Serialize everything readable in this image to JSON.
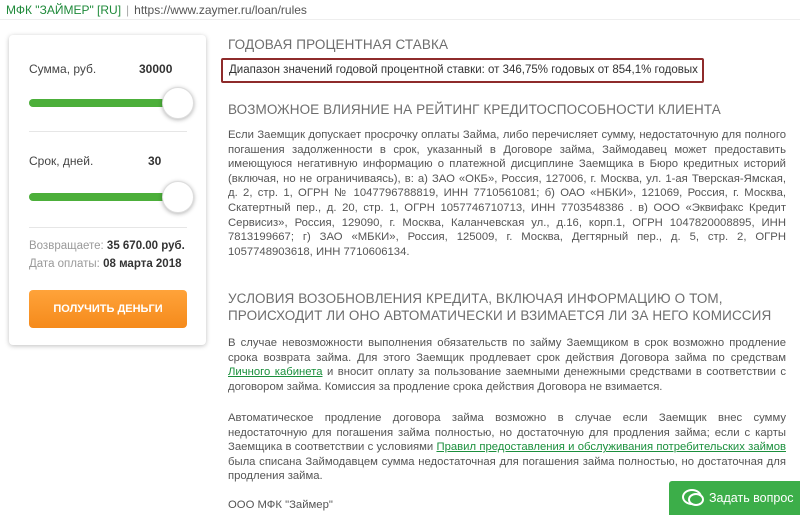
{
  "address_bar": {
    "site_identity": "МФК \"ЗАЙМЕР\" [RU]",
    "url": "https://www.zaymer.ru/loan/rules"
  },
  "calculator": {
    "sum_label": "Сумма, руб.",
    "sum_value": "30000",
    "sum_fraction": 0.94,
    "term_label": "Срок, дней.",
    "term_value": "30",
    "term_fraction": 0.94,
    "return_label": "Возвращаете:",
    "return_value": "35 670.00 руб.",
    "date_label": "Дата оплаты:",
    "date_value": "08 марта 2018",
    "button_label": "ПОЛУЧИТЬ ДЕНЬГИ",
    "accent_color": "#4caf3a",
    "button_color": "#f58a1b"
  },
  "content": {
    "rate_heading": "ГОДОВАЯ ПРОЦЕНТНАЯ СТАВКА",
    "rate_text": "Диапазон значений годовой процентной ставки: от 346,75% годовых от 854,1% годовых",
    "credit_heading": "ВОЗМОЖНОЕ ВЛИЯНИЕ НА РЕЙТИНГ КРЕДИТОСПОСОБНОСТИ КЛИЕНТА",
    "credit_text": "Если Заемщик допускает просрочку оплаты Займа, либо перечисляет сумму, недостаточную для полного погашения задолженности в срок, указанный в Договоре займа, Займодавец может предоставить имеющуюся негативную информацию о платежной дисциплине Заемщика в Бюро кредитных историй (включая, но не ограничиваясь), в: а) ЗАО «ОКБ», Россия, 127006, г. Москва, ул. 1-ая Тверская-Ямская, д. 2, стр. 1, ОГРН № 1047796788819, ИНН 7710561081; б) ОАО «НБКИ», 121069, Россия, г. Москва, Скатертный пер., д. 20, стр. 1, ОГРН 1057746710713, ИНН 7703548386 . в) ООО «Эквифакс Кредит Сервисиз», Россия, 129090, г. Москва, Каланчевская ул., д.16, корп.1, ОГРН 1047820008895, ИНН 7813199667; г) ЗАО «МБКИ», Россия, 125009, г. Москва, Дегтярный пер., д. 5, стр. 2, ОГРН 1057748903618, ИНН 7710606134.",
    "renewal_heading": "УСЛОВИЯ ВОЗОБНОВЛЕНИЯ КРЕДИТА, ВКЛЮЧАЯ ИНФОРМАЦИЮ О ТОМ, ПРОИСХОДИТ ЛИ ОНО АВТОМАТИЧЕСКИ И ВЗИМАЕТСЯ ЛИ ЗА НЕГО КОМИССИЯ",
    "renewal_p1_a": "В случае невозможности выполнения обязательств по займу Заемщиком в срок возможно продление срока возврата займа. Для этого Заемщик продлевает срок действия Договора займа по средствам ",
    "renewal_p1_link": "Личного кабинета",
    "renewal_p1_b": " и вносит оплату за пользование заемными денежными средствами в соответствии с договором займа. Комиссия за продление срока действия Договора не взимается.",
    "renewal_p2_a": "Автоматическое продление договора займа возможно в случае если Заемщик внес сумму недостаточную для погашения займа полностью, но достаточную для продления займа; если с карты Заемщика в соответствии с условиями ",
    "renewal_p2_link": "Правил предоставления и обслуживания потребительских займов",
    "renewal_p2_b": " была списана Займодавцем сумма недостаточная для погашения займа полностью, но достаточная для продления займа.",
    "signature": "ООО МФК \"Займер\""
  },
  "ask_button": {
    "label": "Задать вопрос",
    "icon": "chat-bubbles-icon"
  }
}
